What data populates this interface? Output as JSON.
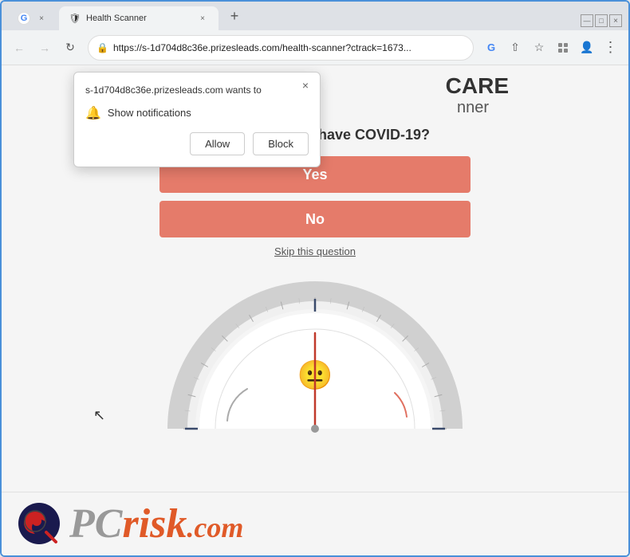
{
  "browser": {
    "tabs": [
      {
        "id": "tab-google",
        "favicon": "G",
        "title": "G",
        "active": false
      },
      {
        "id": "tab-site",
        "favicon": "🛡",
        "title": "Health Scanner",
        "active": true
      }
    ],
    "new_tab_label": "+",
    "nav": {
      "back": "←",
      "forward": "→",
      "refresh": "↻"
    },
    "address": "https://s-1d704d8c36e.prizesleads.com/health-scanner?ctrack=1673...",
    "toolbar_icons": {
      "google": "G",
      "share": "⇧",
      "bookmark": "☆",
      "extensions": "⬜",
      "profile": "👤",
      "menu": "⋮"
    }
  },
  "popup": {
    "title": "s-1d704d8c36e.prizesleads.com wants to",
    "notification_label": "Show notifications",
    "allow_label": "Allow",
    "block_label": "Block",
    "close_icon": "×"
  },
  "page": {
    "header": "CARE",
    "subheader": "nner",
    "question": "Do you currently have COVID-19?",
    "yes_label": "Yes",
    "no_label": "No",
    "skip_label": "Skip this question"
  },
  "footer": {
    "logo_pc": "PC",
    "logo_risk": "risk",
    "logo_dotcom": ".com"
  },
  "gauge": {
    "needle_color": "#c0392b",
    "face_color": "#ffffff",
    "emoji": "😐"
  }
}
